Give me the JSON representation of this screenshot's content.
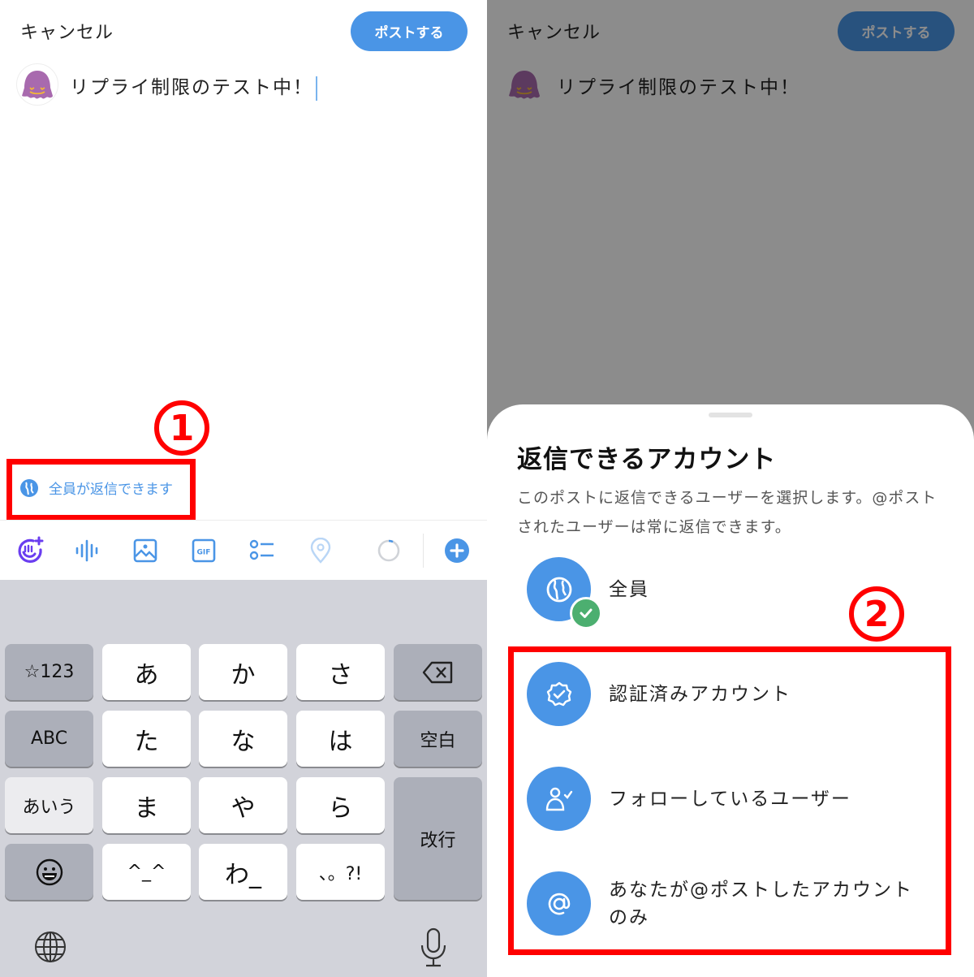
{
  "compose": {
    "cancel_label": "キャンセル",
    "post_button_label": "ポストする",
    "tweet_text": "リプライ制限のテスト中！",
    "reply_setting_label": "全員が返信できます"
  },
  "toolbar": {
    "icons": [
      "grok-icon",
      "voice-icon",
      "image-icon",
      "gif-icon",
      "poll-icon",
      "location-icon",
      "character-count-icon",
      "add-thread-icon"
    ],
    "gif_label": "GIF"
  },
  "keyboard": {
    "rows": [
      [
        "☆123",
        "あ",
        "か",
        "さ",
        "backspace"
      ],
      [
        "ABC",
        "た",
        "な",
        "は",
        "空白"
      ],
      [
        "あいう",
        "ま",
        "や",
        "ら",
        "改行"
      ],
      [
        "emoji",
        "^^",
        "わ",
        "、。?!"
      ]
    ],
    "keys": {
      "num": "☆123",
      "a": "あ",
      "ka": "か",
      "sa": "さ",
      "abc": "ABC",
      "ta": "た",
      "na": "な",
      "ha": "は",
      "space": "空白",
      "aiu": "あいう",
      "ma": "ま",
      "ya": "や",
      "ra": "ら",
      "enter": "改行",
      "kaomoji": "^_^",
      "wa": "わ_",
      "punct": "、。?!"
    }
  },
  "annotations": {
    "step1": "1",
    "step2": "2",
    "color": "#ff0000"
  },
  "reply_sheet": {
    "title": "返信できるアカウント",
    "description": "このポストに返信できるユーザーを選択します。@ポストされたユーザーは常に返信できます。",
    "options": [
      {
        "label": "全員",
        "icon": "globe-icon",
        "selected": true
      },
      {
        "label": "認証済みアカウント",
        "icon": "verified-badge-icon",
        "selected": false
      },
      {
        "label": "フォローしているユーザー",
        "icon": "person-check-icon",
        "selected": false
      },
      {
        "label": "あなたが@ポストしたアカウントのみ",
        "icon": "at-sign-icon",
        "selected": false
      }
    ]
  },
  "colors": {
    "accent": "#4a95e6",
    "check_green": "#4caf70",
    "grok_purple": "#6a3df0"
  }
}
